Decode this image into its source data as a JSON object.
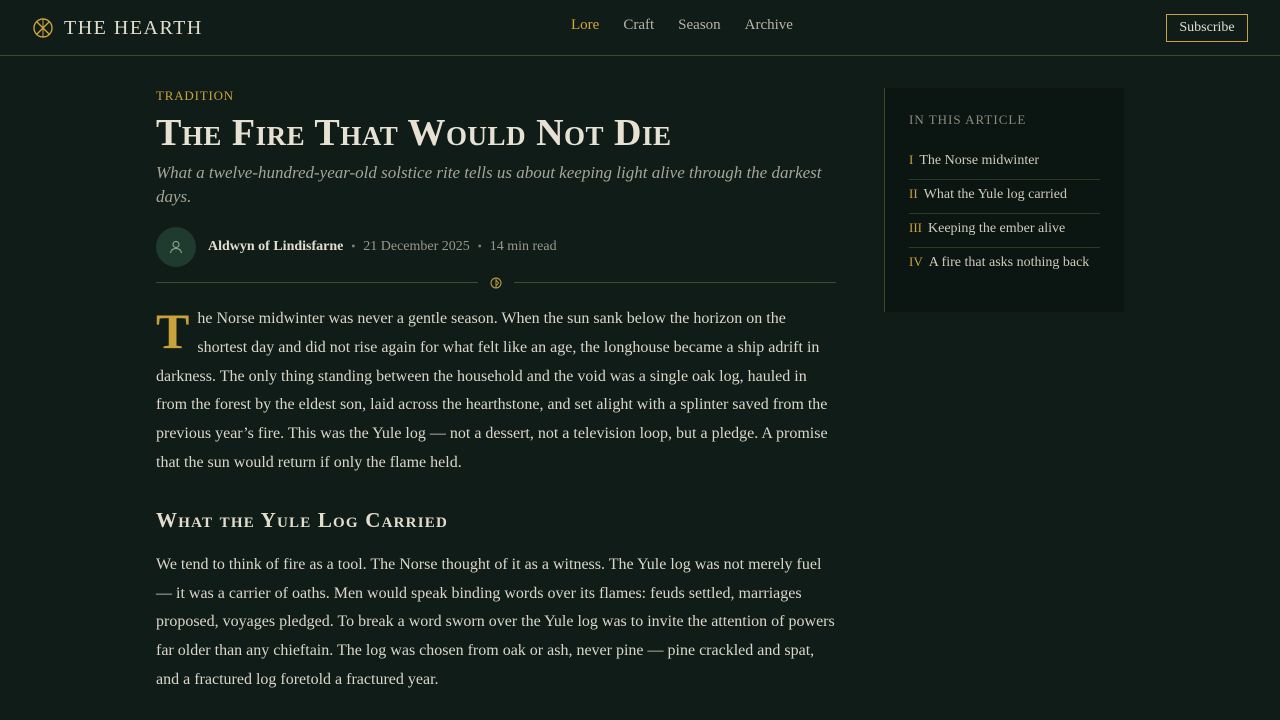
{
  "header": {
    "brand": "THE HEARTH",
    "nav": [
      {
        "label": "Lore",
        "active": true
      },
      {
        "label": "Craft",
        "active": false
      },
      {
        "label": "Season",
        "active": false
      },
      {
        "label": "Archive",
        "active": false
      }
    ],
    "subscribe_label": "Subscribe"
  },
  "article": {
    "kicker": "Tradition",
    "title": "The Fire That Would Not Die",
    "subtitle": "What a twelve-hundred-year-old solstice rite tells us about keeping light alive through the darkest days.",
    "author": "Aldwyn of Lindisfarne",
    "date": "21 December 2025",
    "read_time": "14 min read",
    "p1_dropcap": "T",
    "p1_rest": "he Norse midwinter was never a gentle season. When the sun sank below the horizon on the shortest day and did not rise again for what felt like an age, the longhouse became a ship adrift in darkness. The only thing standing between the household and the void was a single oak log, hauled in from the forest by the eldest son, laid across the hearthstone, and set alight with a splinter saved from the previous year’s fire. This was the Yule log — not a dessert, not a television loop, but a pledge. A promise that the sun would return if only the flame held.",
    "h2": "What the Yule Log Carried",
    "p2": "We tend to think of fire as a tool. The Norse thought of it as a witness. The Yule log was not merely fuel — it was a carrier of oaths. Men would speak binding words over its flames: feuds settled, marriages proposed, voyages pledged. To break a word sworn over the Yule log was to invite the attention of powers far older than any chieftain. The log was chosen from oak or ash, never pine — pine crackled and spat, and a fractured log foretold a fractured year."
  },
  "toc": {
    "heading": "In this article",
    "items": [
      {
        "num": "I",
        "label": "The Norse midwinter"
      },
      {
        "num": "II",
        "label": "What the Yule log carried"
      },
      {
        "num": "III",
        "label": "Keeping the ember alive"
      },
      {
        "num": "IV",
        "label": "A fire that asks nothing back"
      }
    ]
  },
  "colors": {
    "background": "#0f1c18",
    "accent": "#c9a23c",
    "text": "#dcd6c8"
  },
  "icons": {
    "brand": "compass-rune-icon",
    "avatar": "user-icon",
    "divider": "sun-ornament-icon"
  }
}
